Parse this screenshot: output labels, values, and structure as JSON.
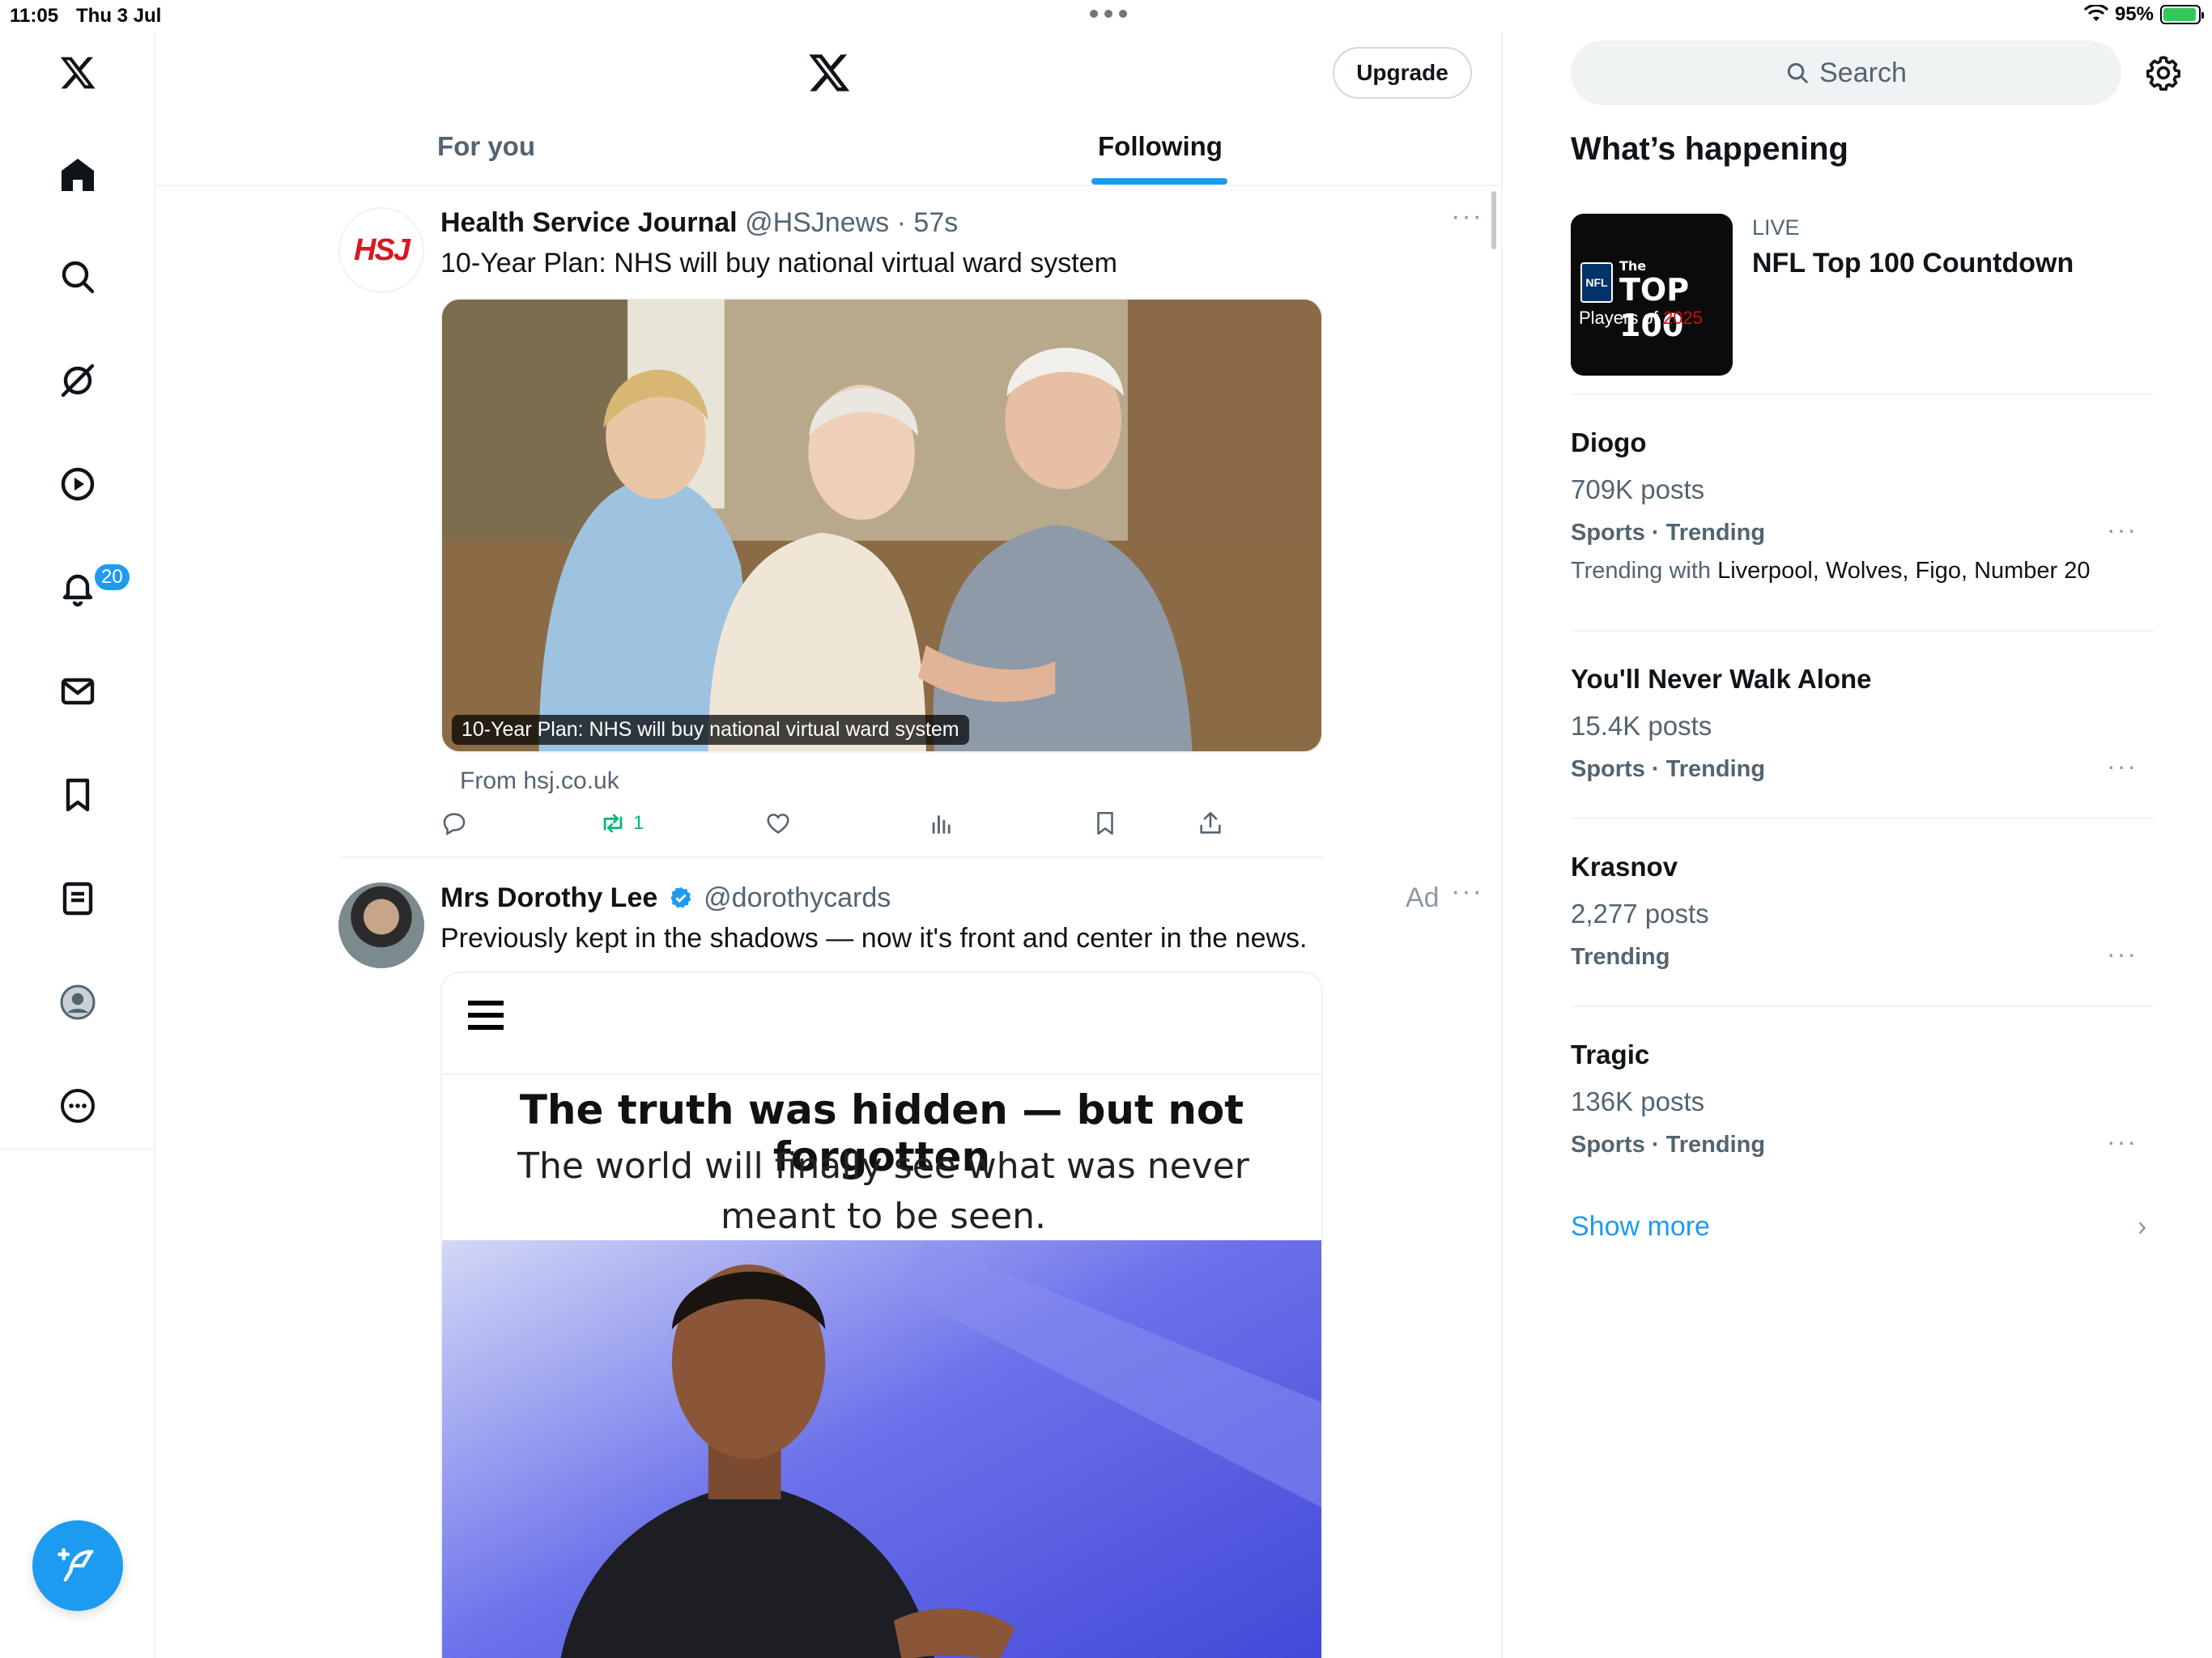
{
  "status_bar": {
    "time": "11:05",
    "date": "Thu 3 Jul",
    "battery": "95%",
    "battery_level": 0.95
  },
  "nav": {
    "items": [
      "home",
      "explore",
      "grok",
      "video",
      "notifications",
      "messages",
      "bookmarks",
      "lists",
      "profile",
      "more"
    ],
    "notification_count": "20"
  },
  "header": {
    "upgrade_label": "Upgrade"
  },
  "tabs": [
    {
      "label": "For you",
      "active": false
    },
    {
      "label": "Following",
      "active": true
    }
  ],
  "tweets": [
    {
      "avatar_text": "HSJ",
      "name": "Health Service Journal",
      "handle": "@HSJnews",
      "time": "57s",
      "text": "10-Year Plan: NHS will buy national virtual ward system",
      "media_caption": "10-Year Plan: NHS will buy national virtual ward system",
      "source": "From hsj.co.uk",
      "retweets": "1"
    },
    {
      "name": "Mrs Dorothy Lee",
      "handle": "@dorothycards",
      "ad_label": "Ad",
      "text": "Previously kept in the shadows — now it's front and center in the news.",
      "card_headline": "The truth was hidden — but not forgotten",
      "card_subtext": "The world will finally see what was never meant to be seen."
    }
  ],
  "sidebar": {
    "search_placeholder": "Search",
    "section_title": "What’s happening",
    "live": {
      "label": "LIVE",
      "title": "NFL Top 100 Countdown",
      "thumb_logo": "NFL",
      "thumb_top_prefix": "The",
      "thumb_top": "TOP 100",
      "thumb_players": "Players of",
      "thumb_year": "2025"
    },
    "trends": [
      {
        "name": "Diogo",
        "posts": "709K posts",
        "category": "Sports · Trending",
        "with_label": "Trending with",
        "with": "Liverpool, Wolves, Figo, Number 20"
      },
      {
        "name": "You'll Never Walk Alone",
        "posts": "15.4K posts",
        "category": "Sports · Trending"
      },
      {
        "name": "Krasnov",
        "posts": "2,277 posts",
        "category": "Trending"
      },
      {
        "name": "Tragic",
        "posts": "136K posts",
        "category": "Sports · Trending"
      }
    ],
    "show_more": "Show more"
  },
  "colors": {
    "accent": "#1d9bf0",
    "retweet": "#00ba7c",
    "text": "#0f1419",
    "muted": "#536471",
    "border": "#eff3f4"
  }
}
